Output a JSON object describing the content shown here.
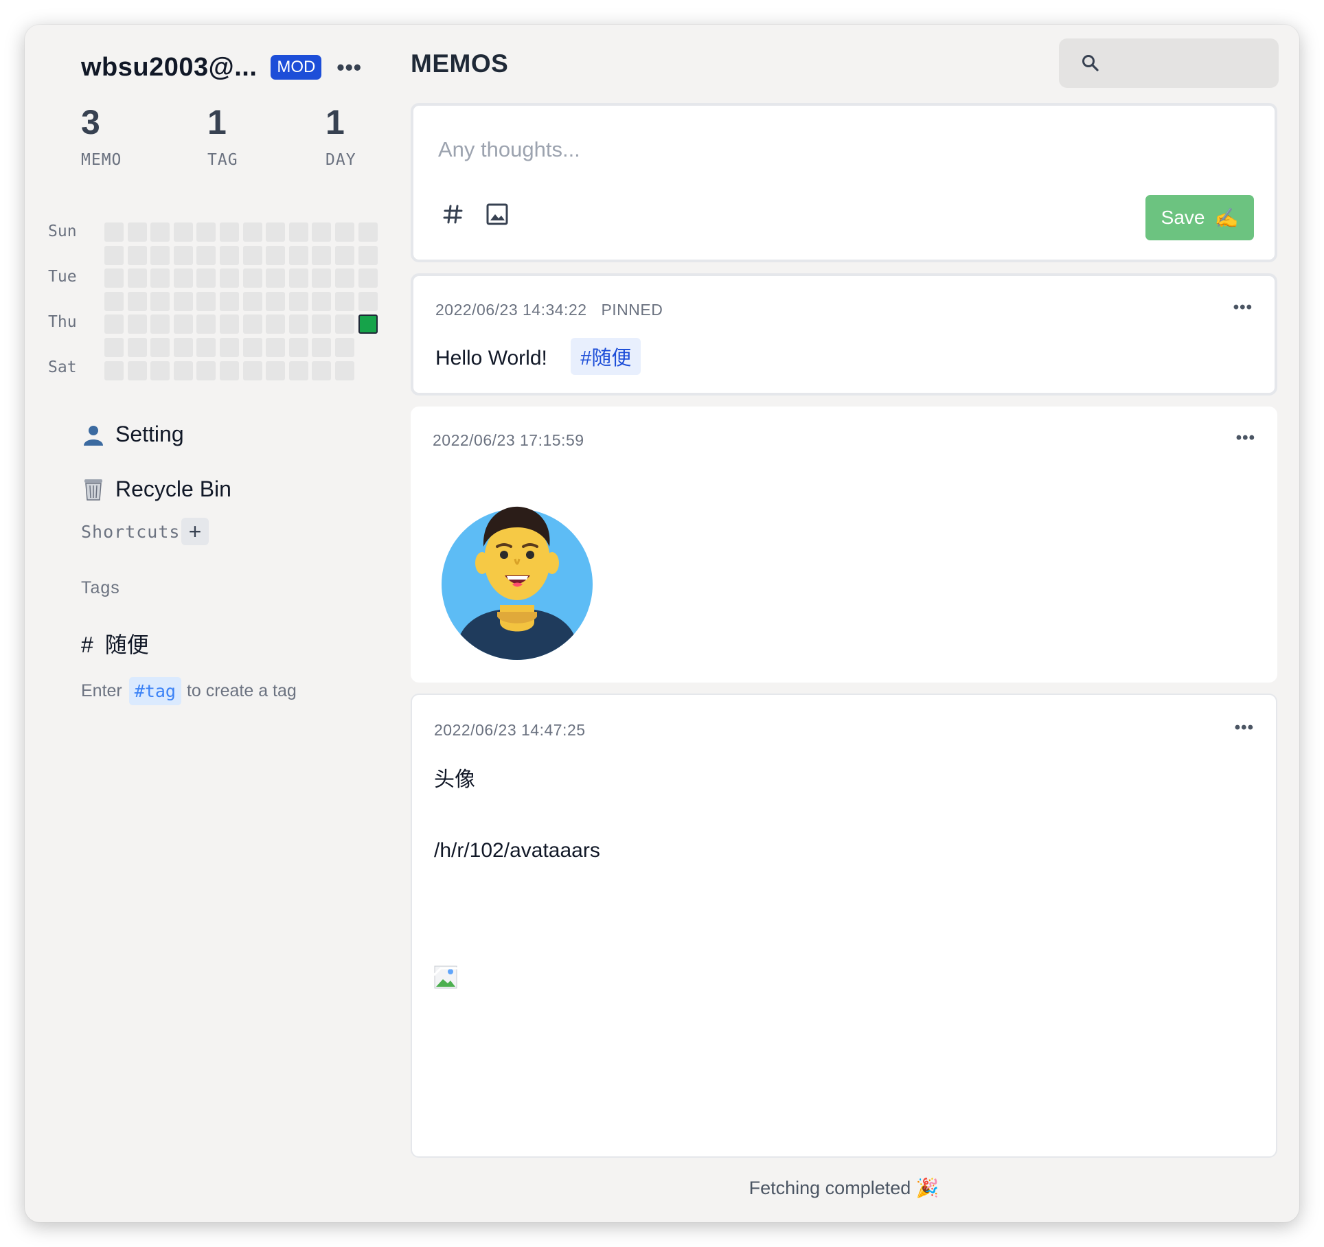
{
  "user": {
    "name": "wbsu2003@...",
    "badge": "MOD",
    "more": "•••"
  },
  "stats": [
    {
      "value": "3",
      "label": "MEMO"
    },
    {
      "value": "1",
      "label": "TAG"
    },
    {
      "value": "1",
      "label": "DAY"
    }
  ],
  "heatmap": {
    "day_labels": [
      "Sun",
      "Tue",
      "Thu",
      "Sat"
    ],
    "active_color": "#16a34a",
    "empty_color": "#e5e5e5"
  },
  "nav": {
    "setting": "Setting",
    "recycle_bin": "Recycle Bin"
  },
  "shortcuts": {
    "title": "Shortcuts",
    "add": "+"
  },
  "tags": {
    "title": "Tags",
    "items": [
      "随便"
    ],
    "hint_prefix": "Enter",
    "hint_code": "#tag",
    "hint_suffix": "to create a tag"
  },
  "header": {
    "title": "MEMOS"
  },
  "editor": {
    "placeholder": "Any thoughts...",
    "save_label": "Save",
    "save_emoji": "✍️"
  },
  "memos": [
    {
      "time": "2022/06/23 14:34:22",
      "status": "PINNED",
      "text": "Hello World!",
      "tag": "#随便",
      "more": "•••"
    },
    {
      "time": "2022/06/23 17:15:59",
      "more": "•••"
    },
    {
      "time": "2022/06/23 14:47:25",
      "title": "头像",
      "link": "/h/r/102/avataaars",
      "more": "•••"
    }
  ],
  "footer": {
    "text": "Fetching completed 🎉"
  },
  "colors": {
    "accent": "#1d4ed8",
    "save": "#6cc380",
    "background": "#f4f3f2"
  }
}
